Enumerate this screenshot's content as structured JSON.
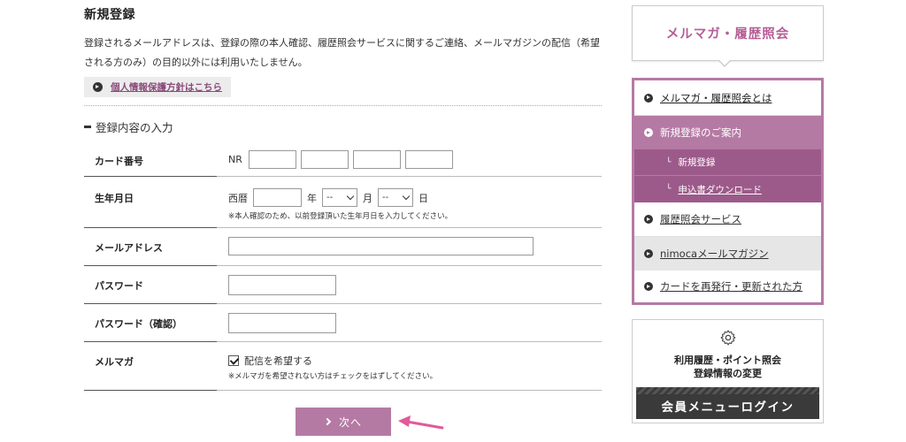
{
  "main": {
    "title": "新規登録",
    "intro": "登録されるメールアドレスは、登録の際の本人確認、履歴照会サービスに関するご連絡、メールマガジンの配信（希望される方のみ）の目的以外には利用いたしません。",
    "privacy_link": "個人情報保護方針はこちら",
    "section_title": "登録内容の入力",
    "form": {
      "card": {
        "label": "カード番号",
        "prefix": "NR"
      },
      "birth": {
        "label": "生年月日",
        "era": "西暦",
        "year_unit": "年",
        "month_value": "--",
        "month_unit": "月",
        "day_value": "--",
        "day_unit": "日",
        "note": "※本人確認のため、以前登録頂いた生年月日を入力してください。"
      },
      "email": {
        "label": "メールアドレス"
      },
      "password": {
        "label": "パスワード"
      },
      "password_confirm": {
        "label": "パスワード（確認）"
      },
      "mailmag": {
        "label": "メルマガ",
        "checkbox_label": "配信を希望する",
        "checked": true,
        "note": "※メルマガを希望されない方はチェックをはずしてください。"
      }
    },
    "next_button": "次へ"
  },
  "sidebar": {
    "header": "メルマガ・履歴照会",
    "menu": [
      {
        "label": "メルマガ・履歴照会とは"
      },
      {
        "label": "新規登録のご案内"
      },
      {
        "label": "新規登録"
      },
      {
        "label": "申込書ダウンロード"
      },
      {
        "label": "履歴照会サービス"
      },
      {
        "label": "nimocaメールマガジン"
      },
      {
        "label": "カードを再発行・更新された方"
      }
    ],
    "member_box": {
      "line1": "利用履歴・ポイント照会",
      "line2": "登録情報の変更",
      "button": "会員メニューログイン"
    }
  },
  "colors": {
    "accent": "#b57aa4",
    "accent_dark": "#9c5a8a",
    "header_text": "#b65d96",
    "arrow": "#e05a9a"
  }
}
